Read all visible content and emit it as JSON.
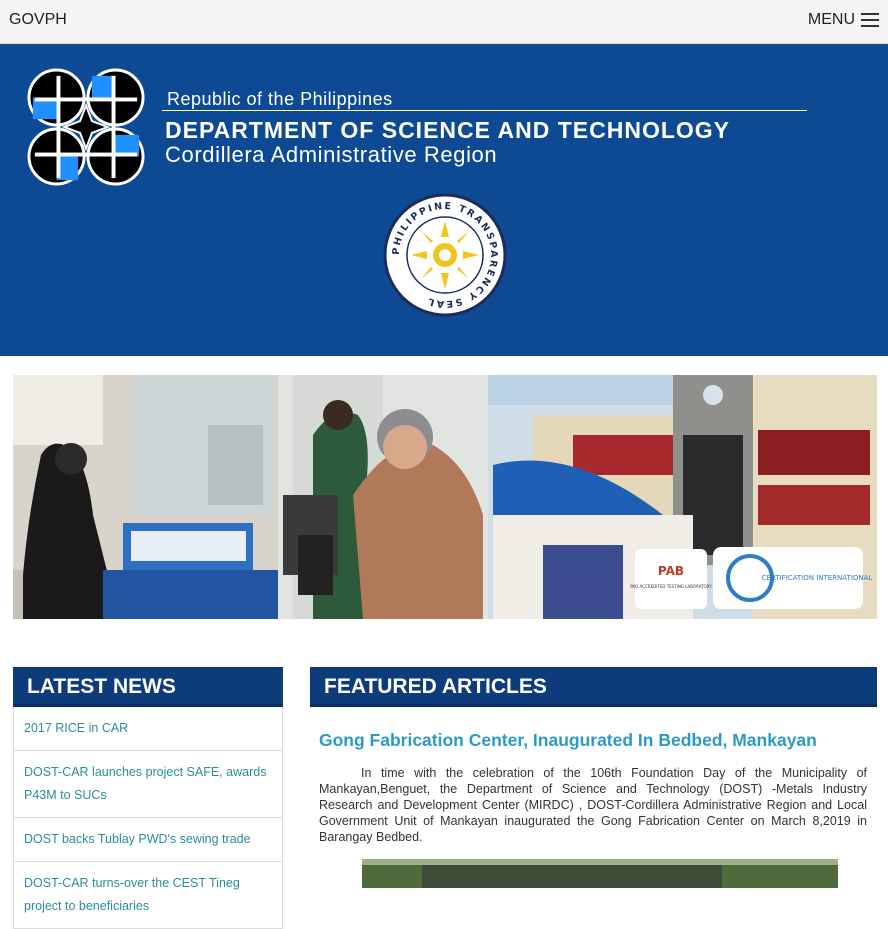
{
  "topbar": {
    "brand": "GOVPH",
    "menu_label": "MENU"
  },
  "banner": {
    "republic": "Republic of the Philippines",
    "department": "DEPARTMENT OF SCIENCE AND TECHNOLOGY",
    "region": "Cordillera Administrative Region",
    "seal_text": "PHILIPPINE TRANSPARENCY SEAL",
    "colors": {
      "background": "#0d4a93",
      "seal_gold": "#f3c41b"
    }
  },
  "hero": {
    "badge_left": "PAO ACCREDITED TESTING LABORATORY",
    "badge_right": "CERTIFICATION INTERNATIONAL"
  },
  "latest_news": {
    "title": "LATEST NEWS",
    "items": [
      "2017 RICE in CAR",
      "DOST-CAR launches project SAFE, awards P43M to SUCs",
      "DOST backs Tublay PWD's sewing trade",
      "DOST-CAR turns-over the CEST Tineg project to beneficiaries"
    ]
  },
  "featured": {
    "title": "FEATURED ARTICLES",
    "article_title": "Gong Fabrication Center, Inaugurated In Bedbed, Mankayan",
    "article_body": "In time with the celebration of the 106th Foundation Day of the Municipality of Mankayan,Benguet, the Department of Science and Technology (DOST) -Metals Industry Research and Development Center (MIRDC) , DOST-Cordillera Administrative Region and Local Government Unit of Mankayan inaugurated the Gong Fabrication Center on March 8,2019 in Barangay Bedbed."
  }
}
